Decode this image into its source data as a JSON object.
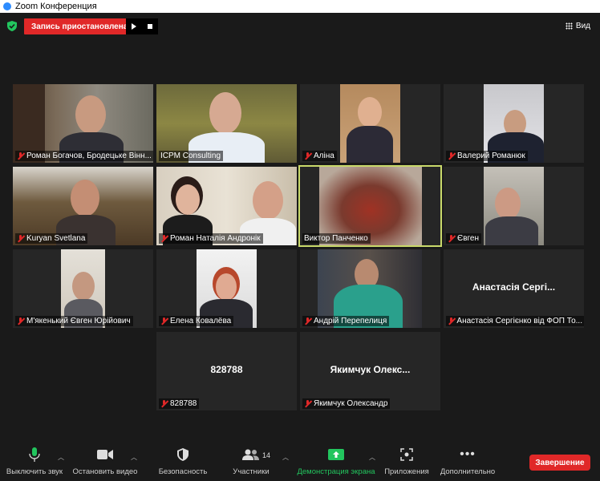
{
  "window": {
    "title": "Zoom Конференция"
  },
  "recording": {
    "status": "Запись приостановлена"
  },
  "view_button": {
    "label": "Вид"
  },
  "participants": [
    {
      "name": "Роман Богачов, Бродецьке Вінн...",
      "muted": true
    },
    {
      "name": "ICPM Consulting",
      "muted": false
    },
    {
      "name": "Аліна",
      "muted": true
    },
    {
      "name": "Валерий Романюк",
      "muted": true
    },
    {
      "name": "Kuryan Svetlana",
      "muted": true
    },
    {
      "name": "Роман Наталія Андронік",
      "muted": true
    },
    {
      "name": "Виктор Панченко",
      "muted": false,
      "active_speaker": true
    },
    {
      "name": "Євген",
      "muted": true
    },
    {
      "name": "М'якенький Євген Юрійович",
      "muted": true
    },
    {
      "name": "Елена Ковалёва",
      "muted": true
    },
    {
      "name": "Андрій Перепелиця",
      "muted": true
    },
    {
      "name": "Анастасія Сергієнко від ФОП То...",
      "muted": true,
      "display_text": "Анастасія  Сергі..."
    },
    {
      "name": "828788",
      "muted": true,
      "display_text": "828788"
    },
    {
      "name": "Якимчук Олександр",
      "muted": true,
      "display_text": "Якимчук  Олекс..."
    }
  ],
  "toolbar": {
    "mute": "Выключить звук",
    "video": "Остановить видео",
    "security": "Безопасность",
    "participants": "Участники",
    "participants_count": "14",
    "share": "Демонстрация экрана",
    "apps": "Приложения",
    "more": "Дополнительно",
    "end": "Завершение"
  },
  "colors": {
    "accent_green": "#22c55e",
    "end_red": "#e02828",
    "active_border": "#c9d96a"
  }
}
